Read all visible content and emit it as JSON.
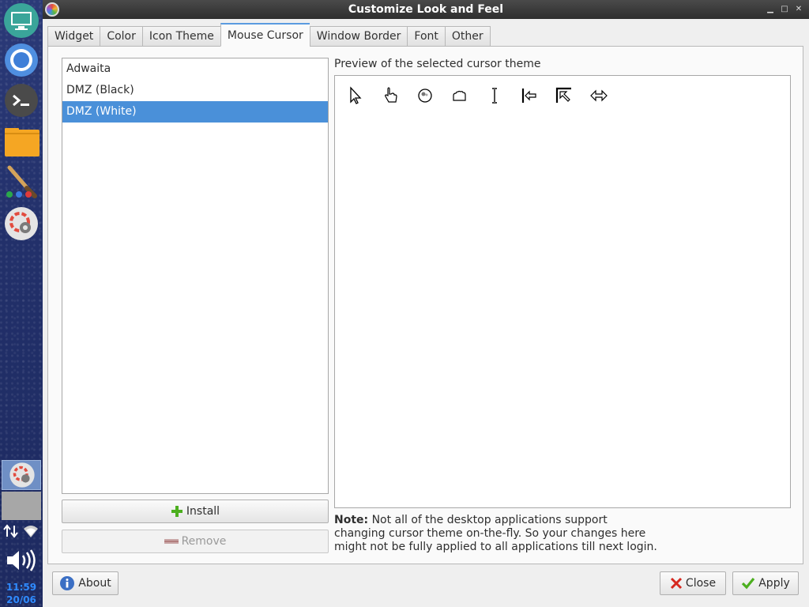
{
  "window": {
    "title": "Customize Look and Feel"
  },
  "dock": {
    "clock_time": "11:59",
    "clock_date": "20/06"
  },
  "tabs": [
    {
      "label": "Widget",
      "active": false
    },
    {
      "label": "Color",
      "active": false
    },
    {
      "label": "Icon Theme",
      "active": false
    },
    {
      "label": "Mouse Cursor",
      "active": true
    },
    {
      "label": "Window Border",
      "active": false
    },
    {
      "label": "Font",
      "active": false
    },
    {
      "label": "Other",
      "active": false
    }
  ],
  "cursor_themes": {
    "items": [
      {
        "label": "Adwaita",
        "selected": false
      },
      {
        "label": "DMZ (Black)",
        "selected": false
      },
      {
        "label": "DMZ (White)",
        "selected": true
      }
    ]
  },
  "buttons": {
    "install": "Install",
    "remove": "Remove",
    "about": "About",
    "close": "Close",
    "apply": "Apply"
  },
  "preview": {
    "label": "Preview of the selected cursor theme",
    "cursors": [
      "arrow-cursor-icon",
      "hand-cursor-icon",
      "watch-cursor-icon",
      "grab-cursor-icon",
      "text-cursor-icon",
      "left-side-cursor-icon",
      "top-left-corner-cursor-icon",
      "h-resize-cursor-icon"
    ]
  },
  "note": {
    "bold": "Note:",
    "line1": " Not all of the desktop applications support",
    "line2": "changing cursor theme on-the-fly. So your changes here",
    "line3": "might not be fully applied to all applications till next login."
  },
  "colors": {
    "selection": "#4a90d9",
    "clock": "#2f8bff",
    "install_icon": "#4caf1f",
    "close_icon": "#d6281f",
    "apply_icon": "#4caf1f"
  }
}
